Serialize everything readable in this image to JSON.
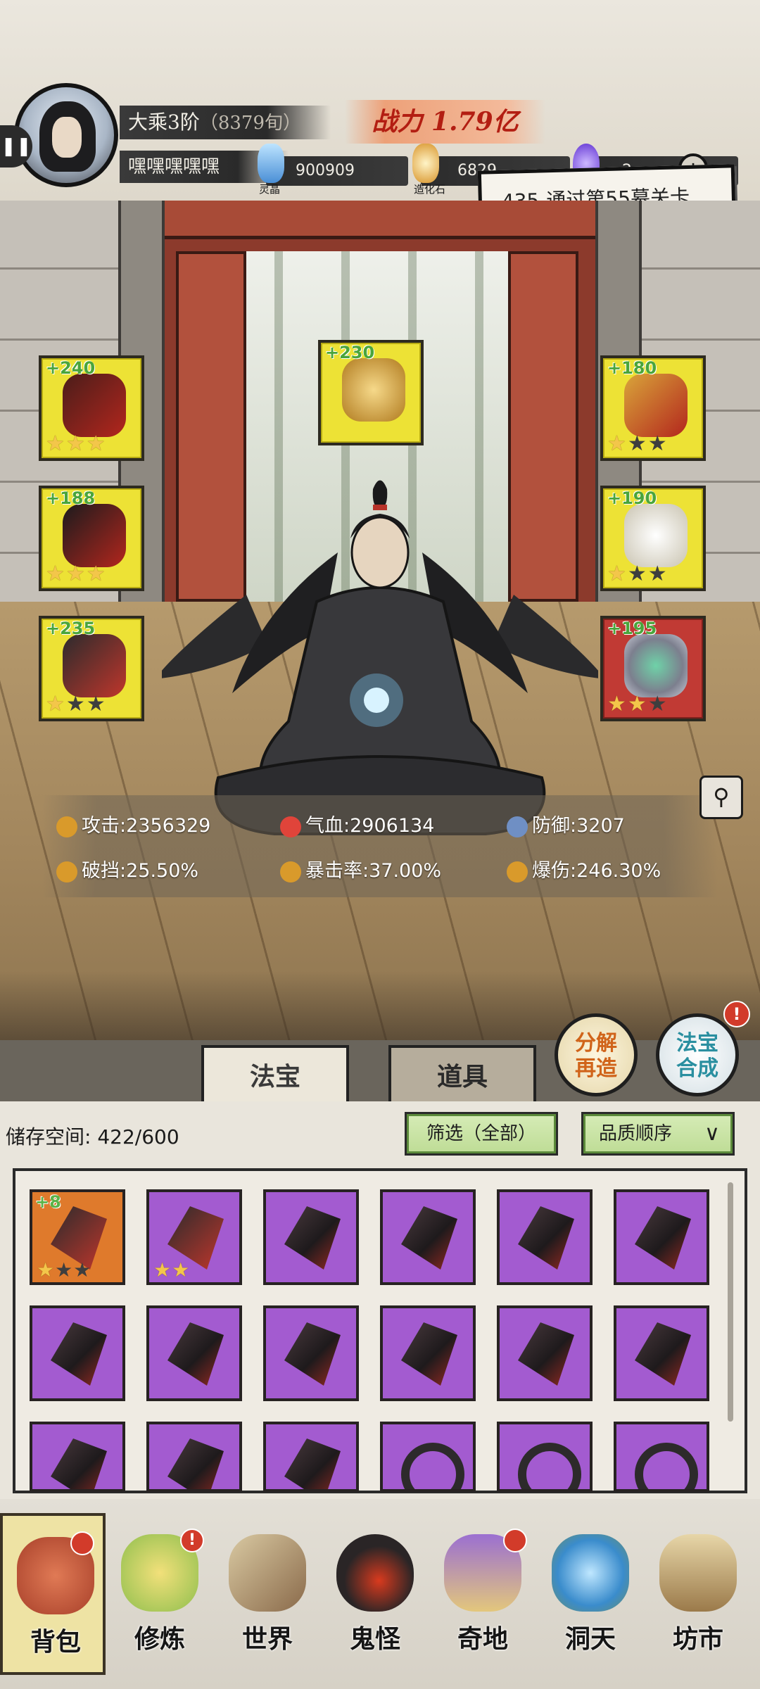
{
  "header": {
    "realm": "大乘3阶",
    "realm_sub": "（8379旬）",
    "player_name": "嘿嘿嘿嘿嘿",
    "power_label": "战力",
    "power_value": "1.79亿",
    "currencies": [
      {
        "label": "灵晶",
        "value": "900909",
        "icon": "crystal-icon"
      },
      {
        "label": "造化石",
        "value": "6829",
        "icon": "stone-icon"
      },
      {
        "label": "",
        "value": "2",
        "icon": "purple-flame-icon"
      }
    ],
    "quest": "435-通过第55幕关卡"
  },
  "equipment": {
    "left": [
      {
        "level": "+240",
        "stars": 3,
        "icon": "dagger-icon"
      },
      {
        "level": "+188",
        "stars": 3,
        "icon": "robe-icon"
      },
      {
        "level": "+235",
        "stars": 1,
        "icon": "boots-icon"
      }
    ],
    "center": {
      "level": "+230",
      "stars": 0,
      "icon": "golden-cloud-icon"
    },
    "right": [
      {
        "level": "+180",
        "stars": 1,
        "icon": "crown-icon"
      },
      {
        "level": "+190",
        "stars": 1,
        "icon": "jade-pendant-icon"
      },
      {
        "level": "+195",
        "stars": 2,
        "icon": "ring-icon"
      }
    ]
  },
  "stats": [
    {
      "label": "攻击",
      "value": "2356329",
      "icon": "sword-icon",
      "color": "#d99a2b"
    },
    {
      "label": "气血",
      "value": "2906134",
      "icon": "heart-icon",
      "color": "#e0443a"
    },
    {
      "label": "防御",
      "value": "3207",
      "icon": "shield-icon",
      "color": "#6f8fc4"
    },
    {
      "label": "破挡",
      "value": "25.50%",
      "icon": "break-icon",
      "color": "#d99a2b"
    },
    {
      "label": "暴击率",
      "value": "37.00%",
      "icon": "crit-icon",
      "color": "#d99a2b"
    },
    {
      "label": "爆伤",
      "value": "246.30%",
      "icon": "crit-damage-icon",
      "color": "#d99a2b"
    }
  ],
  "tabs": {
    "fabao": "法宝",
    "daoju": "道具"
  },
  "actions": {
    "decompose": [
      "分解",
      "再造"
    ],
    "synthesize": [
      "法宝",
      "合成"
    ],
    "synth_badge": "!"
  },
  "inventory": {
    "storage_label": "储存空间:",
    "storage_value": "422/600",
    "filter": "筛选（全部）",
    "sort": "品质顺序",
    "items": [
      {
        "quality": "orange",
        "level": "+8",
        "stars": 1,
        "icon": "boots-icon"
      },
      {
        "quality": "purple",
        "level": "",
        "stars": 2,
        "icon": "boots-icon"
      },
      {
        "quality": "purple",
        "icon": "dagger-icon"
      },
      {
        "quality": "purple",
        "icon": "dagger-icon"
      },
      {
        "quality": "purple",
        "icon": "dagger-icon"
      },
      {
        "quality": "purple",
        "icon": "dagger-icon"
      },
      {
        "quality": "purple",
        "icon": "dagger-icon"
      },
      {
        "quality": "purple",
        "icon": "dagger-icon"
      },
      {
        "quality": "purple",
        "icon": "dagger-icon"
      },
      {
        "quality": "purple",
        "icon": "dagger-icon"
      },
      {
        "quality": "purple",
        "icon": "dagger-icon"
      },
      {
        "quality": "purple",
        "icon": "dagger-icon"
      },
      {
        "quality": "purple",
        "icon": "dagger-icon"
      },
      {
        "quality": "purple",
        "icon": "dagger-icon"
      },
      {
        "quality": "purple",
        "icon": "dagger-icon"
      },
      {
        "quality": "purple",
        "icon": "wheel-icon"
      },
      {
        "quality": "purple",
        "icon": "wheel-icon"
      },
      {
        "quality": "purple",
        "icon": "wheel-icon"
      }
    ]
  },
  "nav": [
    {
      "label": "背包",
      "icon": "bag-icon",
      "badge": true,
      "active": true
    },
    {
      "label": "修炼",
      "icon": "lotus-icon",
      "badge": "!"
    },
    {
      "label": "世界",
      "icon": "scroll-map-icon"
    },
    {
      "label": "鬼怪",
      "icon": "demon-egg-icon"
    },
    {
      "label": "奇地",
      "icon": "mountain-icon",
      "badge": true
    },
    {
      "label": "洞天",
      "icon": "portal-icon"
    },
    {
      "label": "坊市",
      "icon": "shop-icon"
    }
  ],
  "colors": {
    "slot_yellow": "#ede235",
    "slot_red": "#c13a34",
    "purple_quality": "#a35bd0",
    "orange_quality": "#df7a2c",
    "power_text": "#b31e12",
    "green_button": "#bedc95"
  }
}
